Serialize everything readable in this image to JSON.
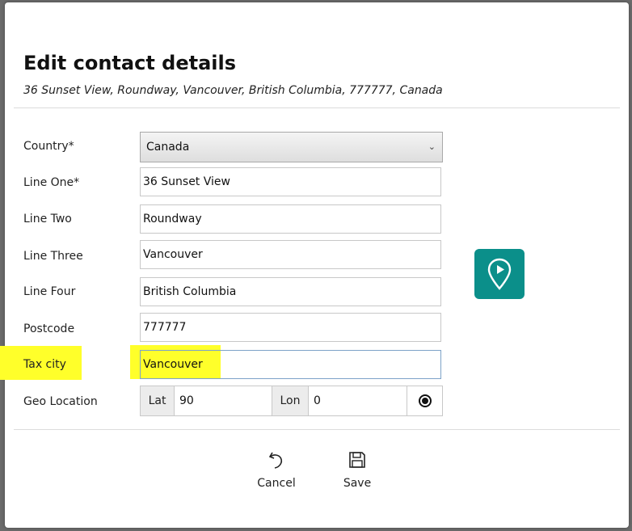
{
  "dialog": {
    "title": "Edit contact details",
    "subtitle": "36 Sunset View, Roundway, Vancouver, British Columbia, 777777, Canada"
  },
  "form": {
    "country": {
      "label": "Country*",
      "value": "Canada"
    },
    "line_one": {
      "label": "Line One*",
      "value": "36 Sunset View"
    },
    "line_two": {
      "label": "Line Two",
      "value": "Roundway"
    },
    "line_three": {
      "label": "Line Three",
      "value": "Vancouver"
    },
    "line_four": {
      "label": "Line Four",
      "value": "British Columbia"
    },
    "postcode": {
      "label": "Postcode",
      "value": "777777"
    },
    "tax_city": {
      "label": "Tax city",
      "value": "Vancouver"
    },
    "geo_location": {
      "label": "Geo Location",
      "lat_label": "Lat",
      "lat_value": "90",
      "lon_label": "Lon",
      "lon_value": "0"
    }
  },
  "actions": {
    "cancel_label": "Cancel",
    "save_label": "Save"
  },
  "icons": {
    "map": "map-pin-play-icon",
    "target": "target-icon",
    "cancel": "undo-icon",
    "save": "floppy-disk-icon",
    "chevron": "chevron-down-icon"
  },
  "colors": {
    "map_button": "#0b8f8a",
    "highlight": "#ffff2a",
    "focus_border": "#7da2c8"
  }
}
